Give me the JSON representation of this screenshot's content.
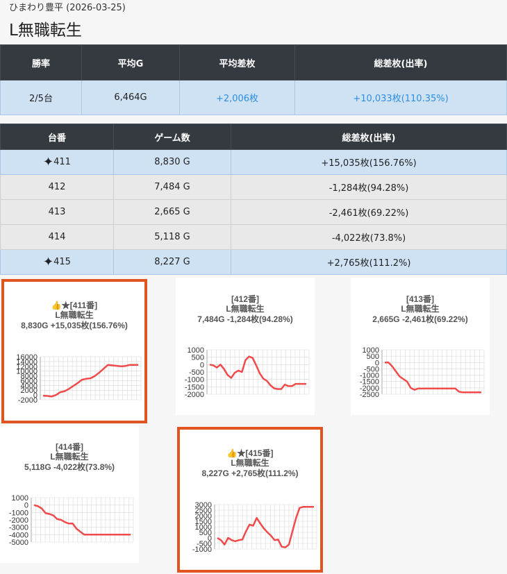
{
  "header": {
    "store": "ひまわり豊平 (2026-03-25)",
    "machine": "L無職転生"
  },
  "summary": {
    "headers": [
      "勝率",
      "平均G",
      "平均差枚",
      "総差枚(出率)"
    ],
    "values": [
      "2/5台",
      "6,464G",
      "+2,006枚",
      "+10,033枚(110.35%)"
    ]
  },
  "machines": {
    "headers": [
      "台番",
      "ゲーム数",
      "総差枚(出率)"
    ],
    "rows": [
      {
        "no": "411",
        "games": "8,830 G",
        "diff": "+15,035枚(156.76%)",
        "win": true
      },
      {
        "no": "412",
        "games": "7,484 G",
        "diff": "-1,284枚(94.28%)",
        "win": false
      },
      {
        "no": "413",
        "games": "2,665 G",
        "diff": "-2,461枚(69.22%)",
        "win": false
      },
      {
        "no": "414",
        "games": "5,118 G",
        "diff": "-4,022枚(73.8%)",
        "win": false
      },
      {
        "no": "415",
        "games": "8,227 G",
        "diff": "+2,765枚(111.2%)",
        "win": true
      }
    ]
  },
  "cards": [
    {
      "label": "👍★[411番]",
      "name": "L無職転生",
      "stat": "8,830G +15,035枚(156.76%)",
      "win": true
    },
    {
      "label": "[412番]",
      "name": "L無職転生",
      "stat": "7,484G -1,284枚(94.28%)",
      "win": false
    },
    {
      "label": "[413番]",
      "name": "L無職転生",
      "stat": "2,665G -2,461枚(69.22%)",
      "win": false
    },
    {
      "label": "[414番]",
      "name": "L無職転生",
      "stat": "5,118G -4,022枚(73.8%)",
      "win": false
    },
    {
      "label": "👍★[415番]",
      "name": "L無職転生",
      "stat": "8,227G +2,765枚(111.2%)",
      "win": true
    }
  ],
  "chart_data": [
    {
      "type": "line",
      "ylim": [
        -2000,
        16000
      ],
      "yticks": [
        "16000",
        "14000",
        "12000",
        "10000",
        "8000",
        "6000",
        "4000",
        "2000",
        "0",
        "-2000"
      ],
      "values": [
        -300,
        -400,
        -600,
        0,
        1200,
        1600,
        2600,
        3800,
        5000,
        6400,
        6800,
        7000,
        8000,
        9400,
        11000,
        12600,
        12400,
        12200,
        12000,
        12100,
        12600,
        12600,
        12600
      ],
      "color": "#f04a4a"
    },
    {
      "type": "line",
      "ylim": [
        -2000,
        1000
      ],
      "yticks": [
        "1000",
        "500",
        "0",
        "-500",
        "-1000",
        "-1500",
        "-2000"
      ],
      "values": [
        0,
        -50,
        -200,
        0,
        -300,
        -700,
        -900,
        -550,
        -400,
        -500,
        300,
        550,
        450,
        -50,
        -600,
        -950,
        -1100,
        -1400,
        -1600,
        -1650,
        -1650,
        -1350,
        -1450,
        -1450,
        -1300,
        -1300,
        -1300,
        -1300
      ],
      "color": "#f04a4a"
    },
    {
      "type": "line",
      "ylim": [
        -2500,
        1000
      ],
      "yticks": [
        "1000",
        "500",
        "0",
        "-500",
        "-1000",
        "-1500",
        "-2000",
        "-2500"
      ],
      "values": [
        0,
        0,
        -300,
        -700,
        -1100,
        -1300,
        -1500,
        -2000,
        -2150,
        -2050,
        -2050,
        -2050,
        -2050,
        -2050,
        -2050,
        -2050,
        -2050,
        -2050,
        -2050,
        -2050,
        -2300,
        -2350,
        -2350,
        -2350,
        -2350,
        -2350,
        -2350
      ],
      "color": "#f04a4a"
    },
    {
      "type": "line",
      "ylim": [
        -5000,
        1000
      ],
      "yticks": [
        "1000",
        "0",
        "-1000",
        "-2000",
        "-3000",
        "-4000",
        "-5000"
      ],
      "values": [
        0,
        -150,
        -450,
        -1100,
        -1200,
        -1400,
        -1900,
        -2000,
        -2300,
        -2500,
        -2500,
        -3200,
        -3600,
        -4000,
        -4000,
        -4000,
        -4000,
        -4000,
        -4000,
        -4000,
        -4000,
        -4000,
        -4000,
        -4000,
        -4000,
        -4000
      ],
      "color": "#f04a4a"
    },
    {
      "type": "line",
      "ylim": [
        -1000,
        3000
      ],
      "yticks": [
        "3000",
        "2500",
        "2000",
        "1500",
        "1000",
        "500",
        "0",
        "-500",
        "-1000"
      ],
      "values": [
        0,
        -200,
        -600,
        0,
        -200,
        -300,
        -200,
        -150,
        600,
        1200,
        1100,
        1800,
        1300,
        850,
        500,
        200,
        -200,
        -150,
        -800,
        -850,
        -600,
        600,
        1800,
        2700,
        2800,
        2800,
        2800,
        2800
      ],
      "color": "#f04a4a"
    }
  ]
}
